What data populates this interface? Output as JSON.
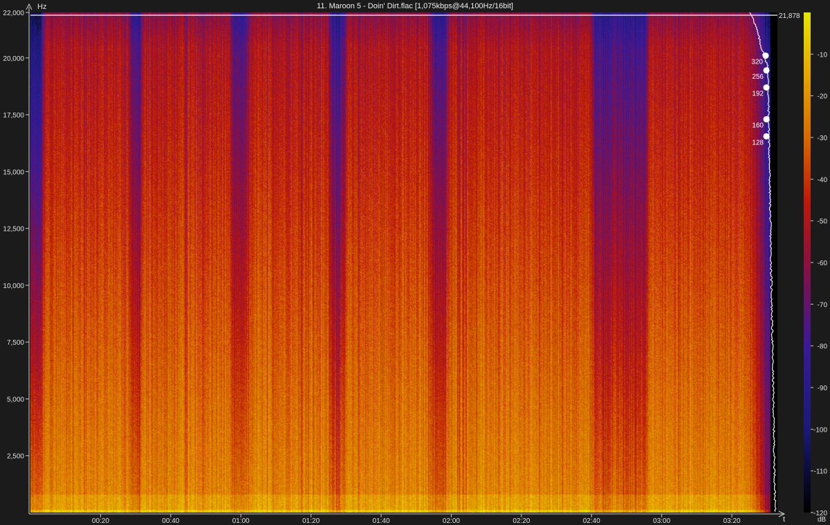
{
  "title": "11. Maroon 5 - Doin' Dirt.flac [1,075kbps@44,100Hz/16bit]",
  "chart_data": {
    "type": "heatmap",
    "title": "11. Maroon 5 - Doin' Dirt.flac [1,075kbps@44,100Hz/16bit]",
    "y_axis": {
      "unit": "Hz",
      "range": [
        0,
        22000
      ],
      "ticks": [
        2500,
        5000,
        7500,
        10000,
        12500,
        15000,
        17500,
        20000,
        22000
      ],
      "tick_labels": [
        "2,500",
        "5,000",
        "7,500",
        "10,000",
        "12,500",
        "15,000",
        "17,500",
        "20,000",
        "22,000"
      ]
    },
    "x_axis": {
      "unit": "t",
      "range_seconds": [
        0,
        213
      ],
      "ticks_seconds": [
        20,
        40,
        60,
        80,
        100,
        120,
        140,
        160,
        180,
        200
      ],
      "tick_labels": [
        "00:20",
        "00:40",
        "01:00",
        "01:20",
        "01:40",
        "02:00",
        "02:20",
        "02:40",
        "03:00",
        "03:20"
      ]
    },
    "color_scale": {
      "unit": "dB",
      "range": [
        -120,
        0
      ],
      "ticks": [
        -10,
        -20,
        -30,
        -40,
        -50,
        -60,
        -70,
        -80,
        -90,
        -100,
        -110,
        -120
      ],
      "tick_labels": [
        "-10",
        "-20",
        "-30",
        "-40",
        "-50",
        "-60",
        "-70",
        "-80",
        "-90",
        "-100",
        "-110",
        "-120"
      ],
      "stops": [
        {
          "db": -120,
          "color": "#000000"
        },
        {
          "db": -100,
          "color": "#191a78"
        },
        {
          "db": -80,
          "color": "#3a1a98"
        },
        {
          "db": -60,
          "color": "#8c1040"
        },
        {
          "db": -45,
          "color": "#c01a0a"
        },
        {
          "db": -30,
          "color": "#d86a00"
        },
        {
          "db": -15,
          "color": "#e6a600"
        },
        {
          "db": 0,
          "color": "#e6e600"
        }
      ]
    },
    "cutoff_reference": {
      "value_hz": 21878,
      "label": "21,878"
    },
    "bitrate_markers": [
      {
        "label": "320",
        "freq_hz": 20100
      },
      {
        "label": "256",
        "freq_hz": 19450
      },
      {
        "label": "192",
        "freq_hz": 18700
      },
      {
        "label": "160",
        "freq_hz": 17300
      },
      {
        "label": "128",
        "freq_hz": 16550
      }
    ],
    "quiet_regions_seconds": [
      [
        0,
        3
      ],
      [
        29,
        31
      ],
      [
        58,
        61
      ],
      [
        86,
        89
      ],
      [
        115,
        118
      ],
      [
        161,
        175
      ]
    ],
    "grid": false
  }
}
